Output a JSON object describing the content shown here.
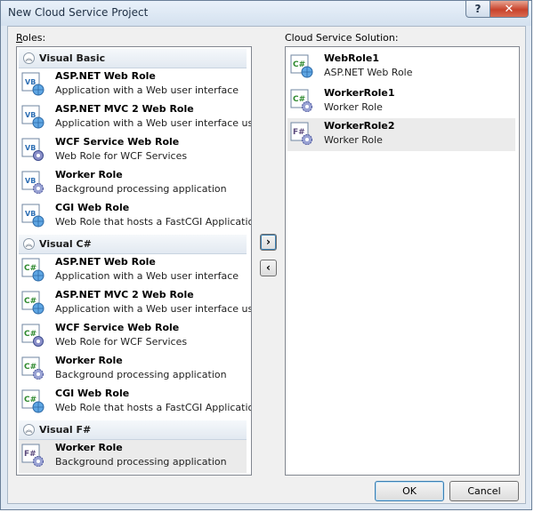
{
  "window": {
    "title": "New Cloud Service Project",
    "help_label": "?",
    "close_label": "✕"
  },
  "roles_label": {
    "mnemonic": "R",
    "rest": "oles:"
  },
  "solution_label": "Cloud Service Solution:",
  "groups": [
    {
      "name": "Visual Basic",
      "items": [
        {
          "name": "ASP.NET Web Role",
          "desc": "Application with a Web user interface"
        },
        {
          "name": "ASP.NET MVC 2 Web Role",
          "desc": "Application with a Web user interface usin..."
        },
        {
          "name": "WCF Service Web Role",
          "desc": "Web Role for WCF Services"
        },
        {
          "name": "Worker Role",
          "desc": "Background processing application"
        },
        {
          "name": "CGI Web Role",
          "desc": "Web Role that hosts a FastCGI Application"
        }
      ]
    },
    {
      "name": "Visual C#",
      "items": [
        {
          "name": "ASP.NET Web Role",
          "desc": "Application with a Web user interface"
        },
        {
          "name": "ASP.NET MVC 2 Web Role",
          "desc": "Application with a Web user interface usin..."
        },
        {
          "name": "WCF Service Web Role",
          "desc": "Web Role for WCF Services"
        },
        {
          "name": "Worker Role",
          "desc": "Background processing application"
        },
        {
          "name": "CGI Web Role",
          "desc": "Web Role that hosts a FastCGI Application"
        }
      ]
    },
    {
      "name": "Visual F#",
      "items": [
        {
          "name": "Worker Role",
          "desc": "Background processing application"
        }
      ]
    }
  ],
  "lang_tags": {
    "vb": "VB",
    "cs": "C#",
    "fs": "F#"
  },
  "solution": [
    {
      "name": "WebRole1",
      "desc": "ASP.NET Web Role"
    },
    {
      "name": "WorkerRole1",
      "desc": "Worker Role"
    },
    {
      "name": "WorkerRole2",
      "desc": "Worker Role"
    }
  ],
  "buttons": {
    "add": "›",
    "remove": "‹",
    "ok": "OK",
    "cancel": "Cancel"
  },
  "colors": {
    "accent": "#3c7fb1",
    "selection": "#ebebeb",
    "close_red": "#c8432c"
  }
}
